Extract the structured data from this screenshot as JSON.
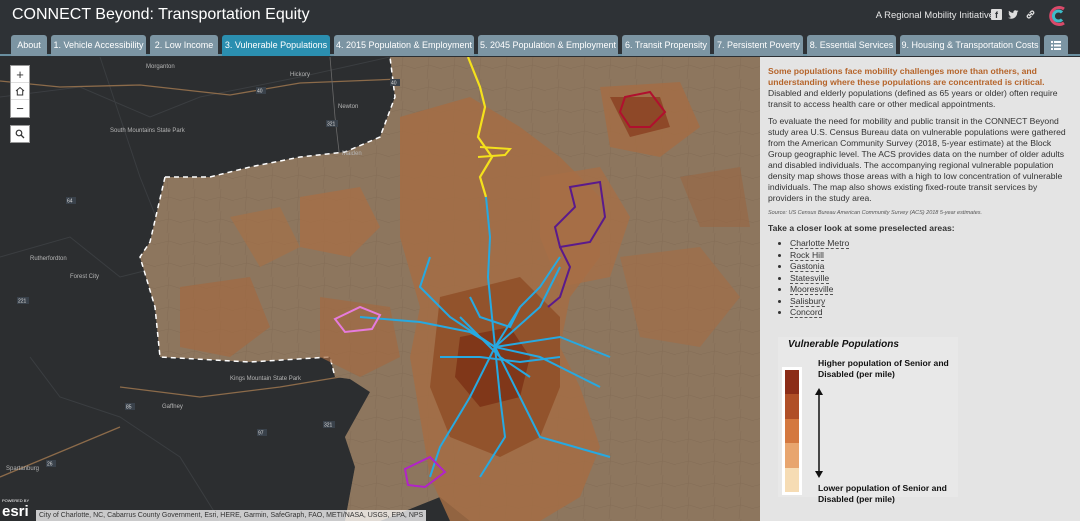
{
  "header": {
    "title": "CONNECT Beyond: Transportation Equity",
    "tagline": "A Regional Mobility Initiative",
    "icons": [
      "facebook-icon",
      "twitter-icon",
      "link-icon"
    ]
  },
  "tabs": [
    {
      "label": "About",
      "active": false
    },
    {
      "label": "1. Vehicle Accessibility",
      "active": false
    },
    {
      "label": "2. Low Income",
      "active": false
    },
    {
      "label": "3. Vulnerable Populations",
      "active": true
    },
    {
      "label": "4. 2015 Population & Employment",
      "active": false
    },
    {
      "label": "5. 2045 Population & Employment",
      "active": false
    },
    {
      "label": "6. Transit Propensity",
      "active": false
    },
    {
      "label": "7. Persistent Poverty",
      "active": false
    },
    {
      "label": "8. Essential Services",
      "active": false
    },
    {
      "label": "9. Housing & Transportation Costs",
      "active": false
    }
  ],
  "map": {
    "zoom_in": "+",
    "zoom_out": "−",
    "attribution": "City of Charlotte, NC, Cabarrus County Government, Esri, HERE, Garmin, SafeGraph, FAO, METI/NASA, USGS, EPA, NPS",
    "esri_powered": "POWERED BY",
    "esri_name": "esri",
    "place_labels": [
      {
        "text": "Morganton"
      },
      {
        "text": "Hickory"
      },
      {
        "text": "Newton"
      },
      {
        "text": "South Mountains State Park"
      },
      {
        "text": "Maiden"
      },
      {
        "text": "Rutherfordton"
      },
      {
        "text": "Forest City"
      },
      {
        "text": "Kings Mountain State Park"
      },
      {
        "text": "Gaffney"
      },
      {
        "text": "Spartanburg"
      }
    ],
    "route_labels": [
      "40",
      "40",
      "321",
      "64",
      "221",
      "85",
      "26",
      "97",
      "321"
    ],
    "colors": {
      "tract_light": "#8f7860",
      "tract_mid": "#a86f45",
      "tract_dark": "#8d4521",
      "tract_darkest": "#7a2a12",
      "route_yellow": "#f4e11c",
      "route_blue": "#27a9e1",
      "route_purple": "#5a1a8c",
      "route_red": "#b0102e",
      "route_pink": "#e67bdc",
      "route_magenta": "#b223c9"
    }
  },
  "panel": {
    "intro_highlight": "Some populations face mobility challenges more than others, and understanding where these populations are concentrated is critical.",
    "intro_rest": " Disabled and elderly populations (defined as 65 years or older) often require transit to access health care or other medical appointments.",
    "body": "To evaluate the need for mobility and public transit in the CONNECT Beyond study area U.S. Census Bureau data on vulnerable populations were gathered from the American Community Survey (2018, 5-year estimate) at the Block Group geographic level. The ACS provides data on the number of older adults and disabled individuals. The accompanying regional vulnerable population density map shows those areas with a high to low concentration of vulnerable individuals. The map also shows existing fixed-route transit services by providers in the study area.",
    "source": "Source: US Census Bureau American Community Survey (ACS) 2018 5-year estimates.",
    "closer": "Take a closer look at some preselected areas:",
    "areas": [
      "Charlotte Metro",
      "Rock Hill",
      "Gastonia",
      "Statesville",
      "Mooresville",
      "Salisbury",
      "Concord"
    ]
  },
  "legend": {
    "title": "Vulnerable Populations",
    "high_label": "Higher population of Senior and Disabled (per mile)",
    "low_label": "Lower population of Senior and Disabled (per mile)",
    "swatches": [
      "#8c2d18",
      "#b04f27",
      "#d4783f",
      "#e8a56e",
      "#f6dcb4"
    ]
  }
}
